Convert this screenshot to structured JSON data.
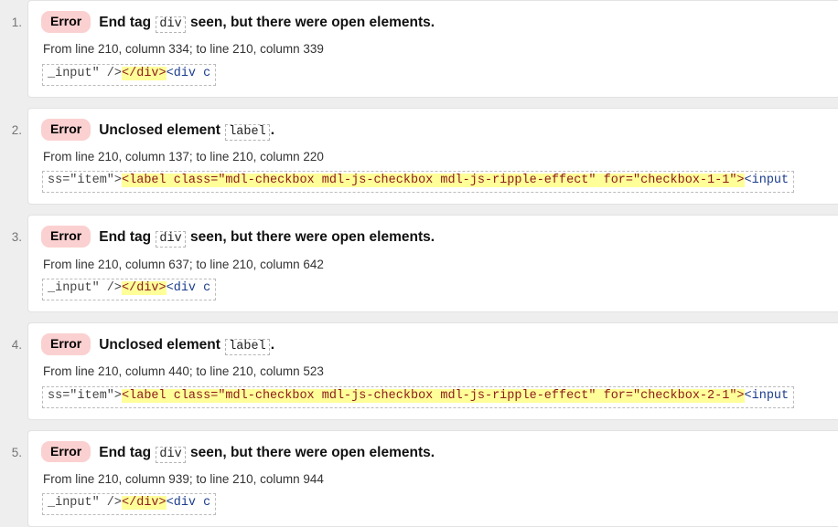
{
  "page": {
    "background_color": "#eeeeee",
    "card_color": "#ffffff",
    "badge_color": "#fbd0d0",
    "highlight_color": "#ffff99"
  },
  "results": [
    {
      "number": "1.",
      "badge": "Error",
      "headline_before": "End tag",
      "headline_code": "div",
      "headline_after": "seen, but there were open elements.",
      "location": "From line 210, column 334; to line 210, column 339",
      "extract": {
        "plain_before": "_input\" />",
        "highlight": "</div>",
        "plain_after": "<div c"
      }
    },
    {
      "number": "2.",
      "badge": "Error",
      "headline_before": "Unclosed element",
      "headline_code": "label",
      "headline_after": ".",
      "location": "From line 210, column 137; to line 210, column 220",
      "extract": {
        "plain_before": "ss=\"item\">",
        "highlight": "<label class=\"mdl-checkbox mdl-js-checkbox mdl-js-ripple-effect\" for=\"checkbox-1-1\">",
        "plain_after": "<input"
      }
    },
    {
      "number": "3.",
      "badge": "Error",
      "headline_before": "End tag",
      "headline_code": "div",
      "headline_after": "seen, but there were open elements.",
      "location": "From line 210, column 637; to line 210, column 642",
      "extract": {
        "plain_before": "_input\" />",
        "highlight": "</div>",
        "plain_after": "<div c"
      }
    },
    {
      "number": "4.",
      "badge": "Error",
      "headline_before": "Unclosed element",
      "headline_code": "label",
      "headline_after": ".",
      "location": "From line 210, column 440; to line 210, column 523",
      "extract": {
        "plain_before": "ss=\"item\">",
        "highlight": "<label class=\"mdl-checkbox mdl-js-checkbox mdl-js-ripple-effect\" for=\"checkbox-2-1\">",
        "plain_after": "<input"
      }
    },
    {
      "number": "5.",
      "badge": "Error",
      "headline_before": "End tag",
      "headline_code": "div",
      "headline_after": "seen, but there were open elements.",
      "location": "From line 210, column 939; to line 210, column 944",
      "extract": {
        "plain_before": "_input\" />",
        "highlight": "</div>",
        "plain_after": "<div c"
      }
    }
  ]
}
